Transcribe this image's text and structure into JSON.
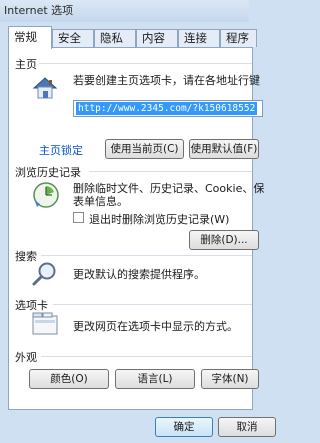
{
  "window": {
    "title": "Internet 选项"
  },
  "tabs": [
    "常规",
    "安全",
    "隐私",
    "内容",
    "连接",
    "程序"
  ],
  "home": {
    "section": "主页",
    "description": "若要创建主页选项卡，请在各地址行键",
    "url": "http://www.2345.com/?k150618552",
    "lock_link": "主页锁定",
    "use_current": "使用当前页(C)",
    "use_default": "使用默认值(F)"
  },
  "history": {
    "section": "浏览历史记录",
    "description_line1": "删除临时文件、历史记录、Cookie、保",
    "description_line2": "表单信息。",
    "checkbox_label": "退出时删除浏览历史记录(W)",
    "delete_button": "删除(D)..."
  },
  "search": {
    "section": "搜索",
    "description": "更改默认的搜索提供程序。"
  },
  "tabs_section": {
    "section": "选项卡",
    "description": "更改网页在选项卡中显示的方式。"
  },
  "appearance": {
    "section": "外观",
    "colors": "颜色(O)",
    "languages": "语言(L)",
    "fonts": "字体(N)"
  },
  "footer": {
    "ok": "确定",
    "cancel": "取消"
  },
  "colors": {
    "accent": "#0a55c9",
    "selection": "#3399ff",
    "chrome": "#cfe0f2"
  }
}
